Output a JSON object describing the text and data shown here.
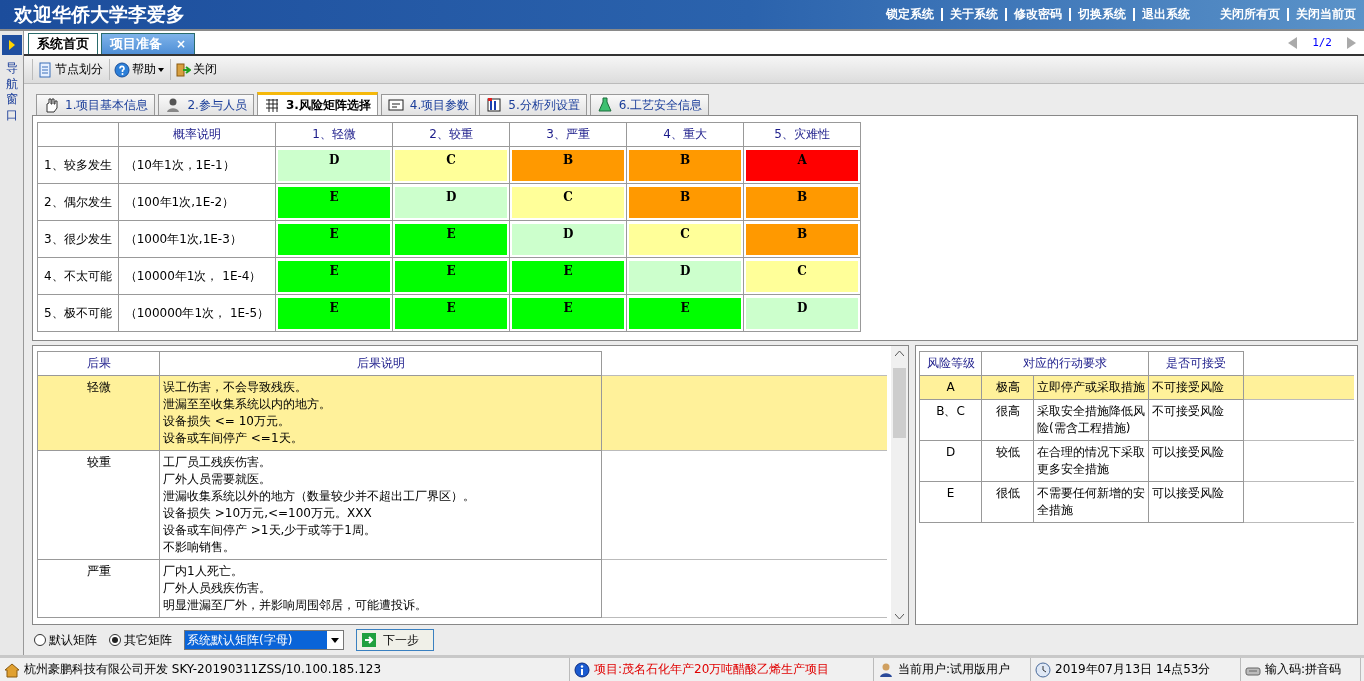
{
  "header": {
    "title": "欢迎华侨大学李爱多",
    "links": [
      "锁定系统",
      "关于系统",
      "修改密码",
      "切换系统",
      "退出系统"
    ],
    "right_links": [
      "关闭所有页",
      "关闭当前页"
    ]
  },
  "nav": {
    "label": "导航窗口"
  },
  "page_tabs": [
    {
      "label": "系统首页",
      "selected": false
    },
    {
      "label": "项目准备",
      "selected": true,
      "close": "×"
    }
  ],
  "pager": "1/2",
  "toolbar": [
    {
      "label": "节点划分",
      "kind": "document"
    },
    {
      "label": "帮助",
      "kind": "help"
    },
    {
      "label": "关闭",
      "kind": "exit"
    }
  ],
  "sub_tabs": [
    {
      "label": "1.项目基本信息",
      "selected": false,
      "kind": "hand"
    },
    {
      "label": "2.参与人员",
      "selected": false,
      "kind": "person"
    },
    {
      "label": "3.风险矩阵选择",
      "selected": true,
      "kind": "grid"
    },
    {
      "label": "4.项目参数",
      "selected": false,
      "kind": "card"
    },
    {
      "label": "5.分析列设置",
      "selected": false,
      "kind": "columns"
    },
    {
      "label": "6.工艺安全信息",
      "selected": false,
      "kind": "flask"
    }
  ],
  "matrix": {
    "desc_header": "概率说明",
    "columns": [
      "1、轻微",
      "2、较重",
      "3、严重",
      "4、重大",
      "5、灾难性"
    ],
    "rows": [
      {
        "label": "1、较多发生",
        "desc": "（10年1次，1E-1）",
        "cells": [
          {
            "grade": "D",
            "color": "#ccffcc"
          },
          {
            "grade": "C",
            "color": "#ffff99"
          },
          {
            "grade": "B",
            "color": "#ff9900"
          },
          {
            "grade": "B",
            "color": "#ff9900"
          },
          {
            "grade": "A",
            "color": "#ff0000"
          }
        ]
      },
      {
        "label": "2、偶尔发生",
        "desc": "（100年1次,1E-2）",
        "cells": [
          {
            "grade": "E",
            "color": "#00ff00"
          },
          {
            "grade": "D",
            "color": "#ccffcc"
          },
          {
            "grade": "C",
            "color": "#ffff99"
          },
          {
            "grade": "B",
            "color": "#ff9900"
          },
          {
            "grade": "B",
            "color": "#ff9900"
          }
        ]
      },
      {
        "label": "3、很少发生",
        "desc": "（1000年1次,1E-3）",
        "cells": [
          {
            "grade": "E",
            "color": "#00ff00"
          },
          {
            "grade": "E",
            "color": "#00ff00"
          },
          {
            "grade": "D",
            "color": "#ccffcc"
          },
          {
            "grade": "C",
            "color": "#ffff99"
          },
          {
            "grade": "B",
            "color": "#ff9900"
          }
        ]
      },
      {
        "label": "4、不太可能",
        "desc": "（10000年1次，  1E-4）",
        "cells": [
          {
            "grade": "E",
            "color": "#00ff00"
          },
          {
            "grade": "E",
            "color": "#00ff00"
          },
          {
            "grade": "E",
            "color": "#00ff00"
          },
          {
            "grade": "D",
            "color": "#ccffcc"
          },
          {
            "grade": "C",
            "color": "#ffff99"
          }
        ]
      },
      {
        "label": "5、极不可能",
        "desc": "（100000年1次，  1E-5）",
        "cells": [
          {
            "grade": "E",
            "color": "#00ff00"
          },
          {
            "grade": "E",
            "color": "#00ff00"
          },
          {
            "grade": "E",
            "color": "#00ff00"
          },
          {
            "grade": "E",
            "color": "#00ff00"
          },
          {
            "grade": "D",
            "color": "#ccffcc"
          }
        ]
      }
    ]
  },
  "consequences": {
    "columns": [
      "后果",
      "后果说明"
    ],
    "rows": [
      {
        "level": "轻微",
        "selected": true,
        "lines": [
          "误工伤害，不会导致残疾。",
          "泄漏至至收集系统以内的地方。",
          "设备损失 <= 10万元。",
          "设备或车间停产 <=1天。"
        ]
      },
      {
        "level": "较重",
        "selected": false,
        "lines": [
          "工厂员工残疾伤害。",
          "厂外人员需要就医。",
          "泄漏收集系统以外的地方（数量较少并不超出工厂界区）。",
          "设备损失 >10万元,<=100万元。XXX",
          "设备或车间停产 >1天,少于或等于1周。",
          "不影响销售。"
        ]
      },
      {
        "level": "严重",
        "selected": false,
        "lines": [
          "厂内1人死亡。",
          "厂外人员残疾伤害。",
          "明显泄漏至厂外，并影响周围邻居，可能遭投诉。"
        ]
      }
    ]
  },
  "risk_levels": {
    "columns": [
      "风险等级",
      "对应的行动要求",
      "是否可接受"
    ],
    "rows": [
      {
        "grade": "A",
        "level": "极高",
        "action": "立即停产或采取措施",
        "acceptance": "不可接受风险",
        "selected": true
      },
      {
        "grade": "B、C",
        "level": "很高",
        "action": "采取安全措施降低风险(需含工程措施)",
        "acceptance": "不可接受风险",
        "selected": false
      },
      {
        "grade": "D",
        "level": "较低",
        "action": "在合理的情况下采取更多安全措施",
        "acceptance": "可以接受风险",
        "selected": false
      },
      {
        "grade": "E",
        "level": "很低",
        "action": "不需要任何新增的安全措施",
        "acceptance": "可以接受风险",
        "selected": false
      }
    ]
  },
  "bottom": {
    "radios": [
      {
        "label": "默认矩阵",
        "selected": false
      },
      {
        "label": "其它矩阵",
        "selected": true
      }
    ],
    "combo": "系统默认矩阵(字母)",
    "next_button": "下一步"
  },
  "status_bar": [
    {
      "kind": "home",
      "text": "杭州豪鹏科技有限公司开发  SKY-20190311ZSS/10.100.185.123"
    },
    {
      "kind": "project",
      "text": "项目:茂名石化年产20万吨醋酸乙烯生产项目"
    },
    {
      "kind": "user",
      "text": "当前用户:试用版用户"
    },
    {
      "kind": "clock",
      "text": "2019年07月13日 14点53分"
    },
    {
      "kind": "input",
      "text": "输入码:拼音码"
    }
  ]
}
